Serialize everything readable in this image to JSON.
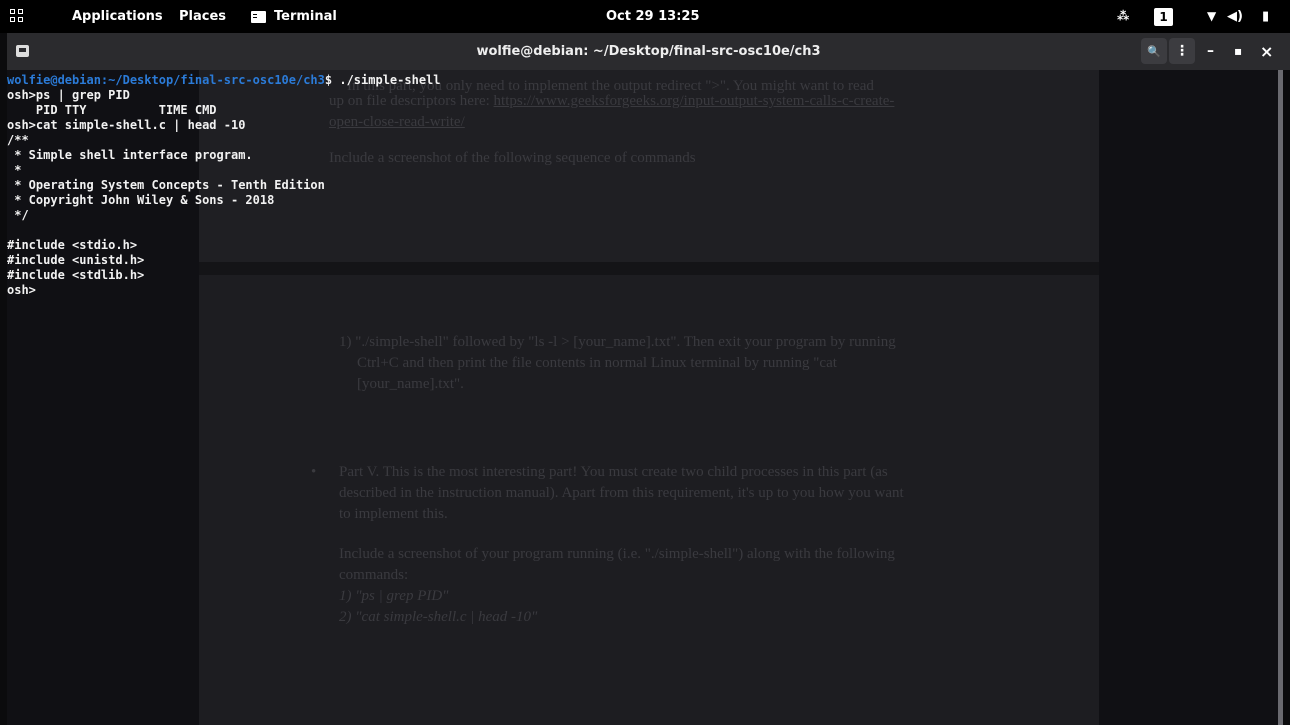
{
  "topbar": {
    "applications": "Applications",
    "places": "Places",
    "terminal": "Terminal",
    "clock": "Oct 29 13:25",
    "workspace": "1",
    "icons": [
      "apps-grid-icon",
      "terminal-icon",
      "network-icon",
      "wifi-icon",
      "volume-icon",
      "battery-icon"
    ]
  },
  "window": {
    "title": "wolfie@debian: ~/Desktop/final-src-osc10e/ch3",
    "search_icon": "🔍",
    "menu_icon": "⋮",
    "minimize": "–",
    "maximize": "▪",
    "close": "×"
  },
  "prompt": {
    "user_host": "wolfie@debian",
    "path": ":~/Desktop/final-src-osc10e/ch3",
    "symbol": "$",
    "command": " ./simple-shell"
  },
  "output_lines": [
    "osh>ps | grep PID",
    "    PID TTY          TIME CMD",
    "osh>cat simple-shell.c | head -10",
    "/**",
    " * Simple shell interface program.",
    " *",
    " * Operating System Concepts - Tenth Edition",
    " * Copyright John Wiley & Sons - 2018",
    " */",
    "",
    "#include <stdio.h>",
    "#include <unistd.h>",
    "#include <stdlib.h>",
    "osh>"
  ],
  "background_doc": {
    "line1": "In this part, you only need to implement the output redirect \">\". You might want to read",
    "line2_pre": "up on file descriptors here: ",
    "line2_link": "https://www.geeksforgeeks.org/input-output-system-calls-c-create-",
    "line3_link": "open-close-read-write/",
    "line4": "Include a screenshot of the following sequence of commands",
    "item1_a": "1) \"./simple-shell\" followed by \"ls -l > [your_name].txt\". Then exit your program by running",
    "item1_b": "Ctrl+C and then print the file contents in normal Linux terminal by running \"cat",
    "item1_c": "[your_name].txt\".",
    "bullet": "•",
    "part5_a": "Part V. This is the most interesting part! You must create two child processes in this part (as",
    "part5_b": "described in the instruction manual). Apart from this requirement, it's up to you how you want",
    "part5_c": "to implement this.",
    "inc_a": "Include a screenshot of your program running (i.e. \"./simple-shell\") along with the following",
    "inc_b": "commands:",
    "cmd1": "1) \"ps | grep PID\"",
    "cmd2": "2) \"cat simple-shell.c | head -10\""
  },
  "colors": {
    "prompt_blue": "#2b7bd8",
    "terminal_bg": "#101014",
    "titlebar_bg": "#2b2b2e"
  }
}
